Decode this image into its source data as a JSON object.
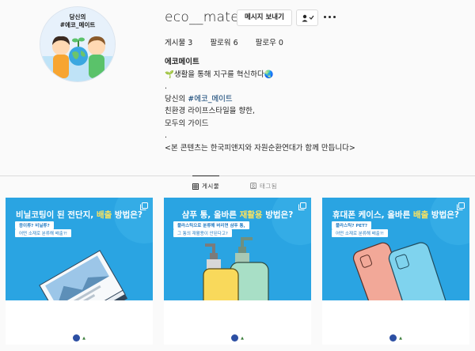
{
  "profile": {
    "username": "eco__mate",
    "message_button": "메시지 보내기",
    "avatar_text_line1": "당신의",
    "avatar_text_line2": "#에코_메이트"
  },
  "stats": {
    "posts_label": "게시물",
    "posts_count": "3",
    "followers_label": "팔로워",
    "followers_count": "6",
    "following_label": "팔로우",
    "following_count": "0"
  },
  "bio": {
    "name": "에코메이트",
    "line1": "🌱생활을 통해 지구를 혁신하다🌏",
    "line2": ".",
    "line3_prefix": "당신의 ",
    "line3_hashtag": "#에코_메이트",
    "line4": "친환경 라이프스타일을 향한,",
    "line5": "모두의 가이드",
    "line6": ".",
    "line7": "<본 콘텐츠는 한국피앤지와 자원순환연대가 함께 만듭니다>"
  },
  "tabs": {
    "posts": "게시물",
    "tagged": "태그됨"
  },
  "posts": [
    {
      "title_pre": "비닐코팅이 된 전단지, ",
      "title_hl": "배출",
      "title_post": " 방법은?",
      "q1": "종이류? 비닐류?",
      "q2": "어떤 소재로 분류해 배출?!"
    },
    {
      "title_pre": "샴푸 통, 올바른 ",
      "title_hl": "재활용",
      "title_post": " 방법은?",
      "q1": "플라스틱으로 분류해 버리면 샴푸 통,",
      "q2": "그 통의 재활용이 안된다고?"
    },
    {
      "title_pre": "휴대폰 케이스, 올바른 ",
      "title_hl": "배출",
      "title_post": " 방법은?",
      "q1": "플라스틱? PET?",
      "q2": "어떤 소재로 분류해 배출?!"
    }
  ],
  "colors": {
    "tile_blue": "#2aa4e2",
    "highlight": "#ffe45c",
    "hashtag": "#00376b"
  }
}
